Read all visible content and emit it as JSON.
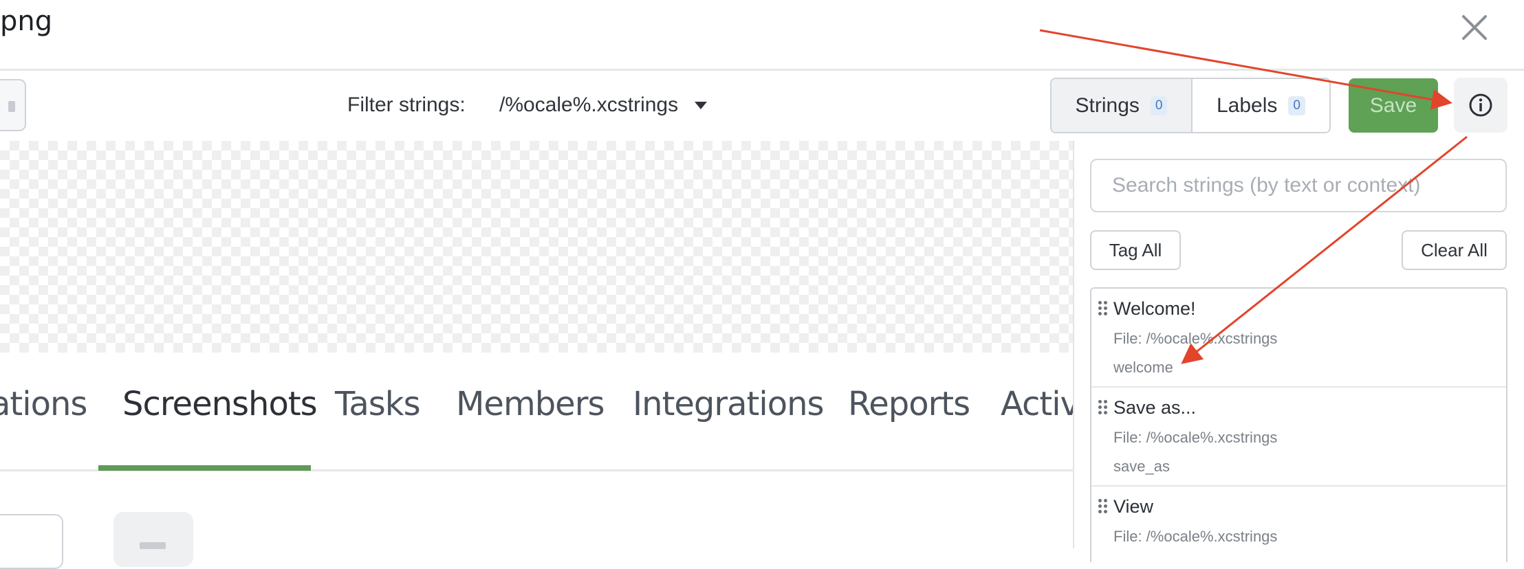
{
  "header": {
    "title": "png",
    "close_icon": "close-icon"
  },
  "toolbar": {
    "filter_label": "Filter strings:",
    "filter_value": "/%ocale%.xcstrings",
    "segments": {
      "strings_label": "Strings",
      "strings_count": "0",
      "labels_label": "Labels",
      "labels_count": "0"
    },
    "save_label": "Save",
    "info_icon": "info-icon"
  },
  "tabs": [
    {
      "label": "ations"
    },
    {
      "label": "Screenshots"
    },
    {
      "label": "Tasks"
    },
    {
      "label": "Members"
    },
    {
      "label": "Integrations"
    },
    {
      "label": "Reports"
    },
    {
      "label": "Activi"
    }
  ],
  "active_tab": "Screenshots",
  "side_panel": {
    "search_placeholder": "Search strings (by text or context)",
    "tag_all_label": "Tag All",
    "clear_all_label": "Clear All",
    "strings": [
      {
        "title": "Welcome!",
        "file": "File: /%ocale%.xcstrings",
        "key": "welcome"
      },
      {
        "title": "Save as...",
        "file": "File: /%ocale%.xcstrings",
        "key": "save_as"
      },
      {
        "title": "View",
        "file": "File: /%ocale%.xcstrings",
        "key": ""
      }
    ]
  },
  "colors": {
    "accent_green": "#5fa155",
    "annotation_arrow": "#e2442c",
    "badge_blue": "#3f78c0"
  }
}
